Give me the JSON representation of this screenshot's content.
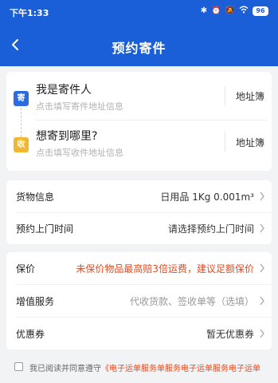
{
  "status_bar": {
    "time": "下午1:33",
    "battery": "96"
  },
  "nav": {
    "title": "预约寄件"
  },
  "sender": {
    "tag": "寄",
    "title": "我是寄件人",
    "hint": "点击填写寄件地址信息",
    "book": "地址簿"
  },
  "receiver": {
    "tag": "收",
    "title": "想寄到哪里?",
    "hint": "点击填写收件地址信息",
    "book": "地址簿"
  },
  "goods": {
    "label": "货物信息",
    "value": "日用品  1Kg  0.001m³"
  },
  "pickup": {
    "label": "预约上门时间",
    "value": "请选择预约上门时间"
  },
  "insurance": {
    "label": "保价",
    "value": "未保价物品最高赔3倍运费，建议足额保价"
  },
  "value_added": {
    "label": "增值服务",
    "value": "代收货款、签收单等（选填）"
  },
  "coupon": {
    "label": "优惠券",
    "value": "暂无优惠券"
  },
  "agreement": {
    "prefix": "我已阅读并同意遵守",
    "link": "《电子运单服务单服务电子运单服务电子运单"
  },
  "colors": {
    "header_blue": "#1b5fd8",
    "sender_tag": "#2b6ce0",
    "receiver_tag": "#f2b731",
    "warning": "#e8491d"
  }
}
